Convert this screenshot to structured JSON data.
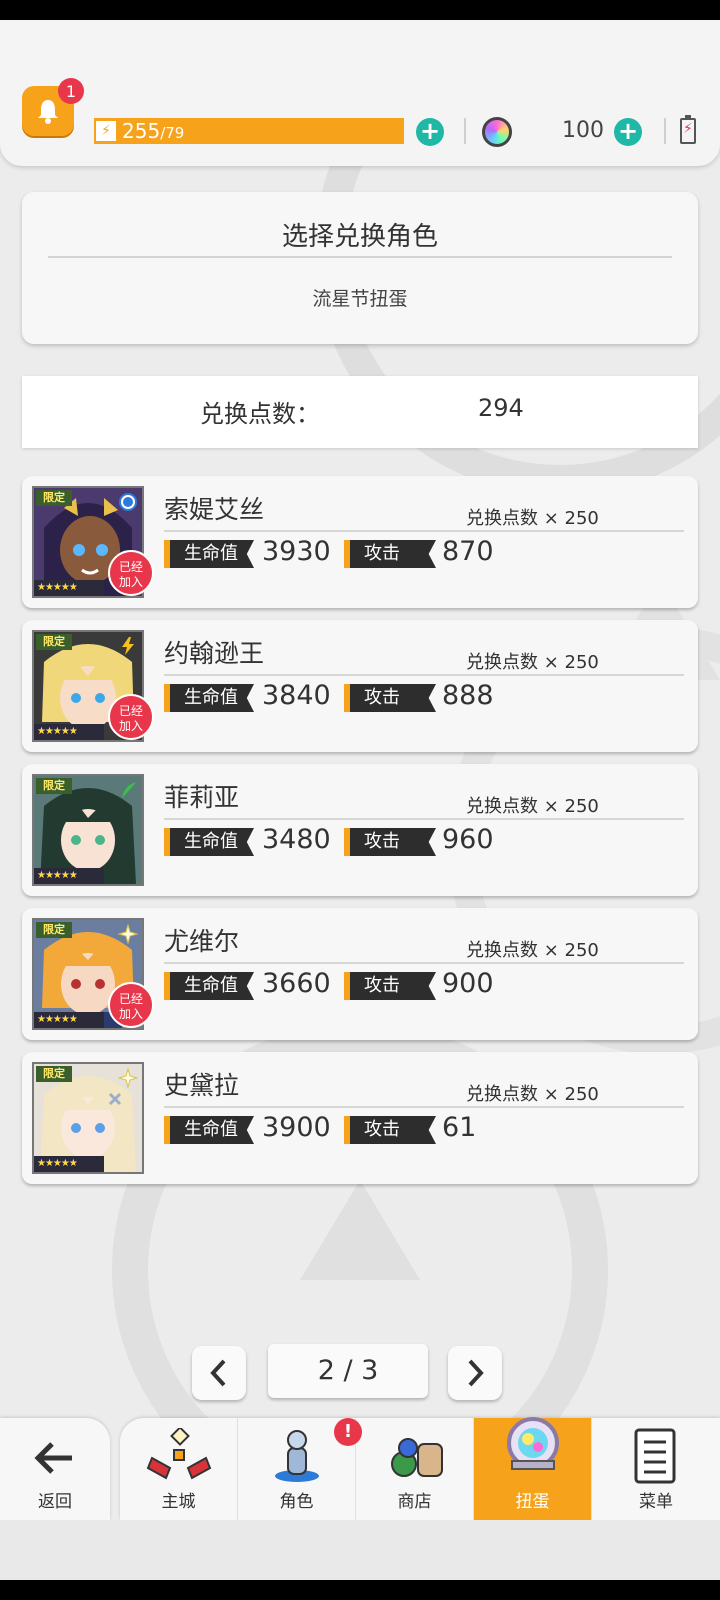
{
  "header": {
    "notification_count": "1",
    "energy_current": "255",
    "energy_max": "/79",
    "gem_count": "100"
  },
  "title_card": {
    "title": "选择兑换角色",
    "subtitle": "流星节扭蛋"
  },
  "points": {
    "label": "兑换点数：",
    "value": "294"
  },
  "labels": {
    "limited": "限定",
    "hp": "生命值",
    "attack": "攻击",
    "joined_line1": "已经",
    "joined_line2": "加入",
    "stars": "★★★★★"
  },
  "characters": [
    {
      "name": "索媞艾丝",
      "cost": "兑换点数 × 250",
      "hp": "3930",
      "attack": "870",
      "joined": true,
      "element_icon": "water-element-icon"
    },
    {
      "name": "约翰逊王",
      "cost": "兑换点数 × 250",
      "hp": "3840",
      "attack": "888",
      "joined": true,
      "element_icon": "thunder-element-icon"
    },
    {
      "name": "菲莉亚",
      "cost": "兑换点数 × 250",
      "hp": "3480",
      "attack": "960",
      "joined": false,
      "element_icon": "wind-element-icon"
    },
    {
      "name": "尤维尔",
      "cost": "兑换点数 × 250",
      "hp": "3660",
      "attack": "900",
      "joined": true,
      "element_icon": "light-element-icon"
    },
    {
      "name": "史黛拉",
      "cost": "兑换点数 × 250",
      "hp": "3900",
      "attack": "61",
      "joined": false,
      "element_icon": "light-element-icon"
    }
  ],
  "pagination": {
    "indicator": "2 / 3"
  },
  "nav": {
    "back": "返回",
    "items": [
      {
        "label": "主城",
        "icon": "town-icon",
        "active": false
      },
      {
        "label": "角色",
        "icon": "character-icon",
        "active": false
      },
      {
        "label": "商店",
        "icon": "shop-icon",
        "active": false
      },
      {
        "label": "扭蛋",
        "icon": "gacha-icon",
        "active": true
      },
      {
        "label": "菜单",
        "icon": "menu-icon",
        "active": false
      }
    ],
    "alert_mark": "!"
  },
  "colors": {
    "accent": "#f7a21b",
    "teal": "#1fb8a6",
    "badge_red": "#e8374a",
    "stat_dark": "#2d2d2d"
  }
}
